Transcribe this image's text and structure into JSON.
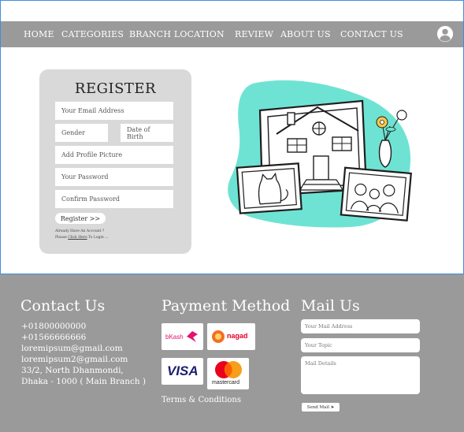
{
  "nav": {
    "items": [
      "HOME",
      "CATEGORIES",
      "BRANCH  LOCATION",
      "REVIEW",
      "ABOUT  US",
      "CONTACT  US"
    ]
  },
  "register": {
    "title": "REGISTER",
    "email_placeholder": "Your Email Address",
    "gender_placeholder": "Gender",
    "dob_placeholder": "Date of Birth",
    "picture_placeholder": "Add Profile Picture",
    "password_placeholder": "Your Password",
    "confirm_placeholder": "Confirm Password",
    "button_label": "Register  >>",
    "note_line1": "Already Have An Account ?",
    "note_please": "Please ",
    "note_link": "Click Here",
    "note_tail": " To Login ..."
  },
  "footer": {
    "contact": {
      "title": "Contact Us",
      "lines": [
        "+01800000000",
        "+01566666666",
        "loremipsum@gmail.com",
        "loremipsum2@gmail.com",
        "33/2, North Dhanmondi,",
        "Dhaka - 1000 ( Main Branch )"
      ]
    },
    "payment": {
      "title": "Payment Method",
      "methods": [
        "bKash",
        "nagad",
        "VISA",
        "mastercard"
      ],
      "terms": "Terms & Conditions"
    },
    "mail": {
      "title": "Mail Us",
      "address_placeholder": "Your Mail Address",
      "topic_placeholder": "Your Topic",
      "details_placeholder": "Mail Details",
      "send_label": "Send Mail  ➤"
    }
  },
  "colors": {
    "nav_bg": "#9a9a9a",
    "panel_bg": "#d9d9d9",
    "footer_bg": "#9a9a9a",
    "illustration_accent": "#6fe3d3",
    "frame_border": "#3d8fe0"
  }
}
